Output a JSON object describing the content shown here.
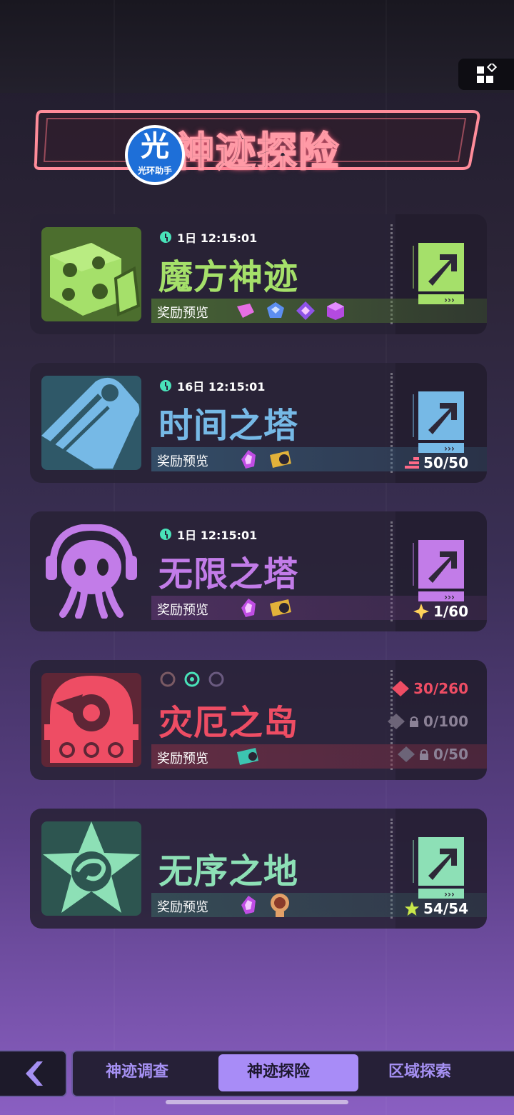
{
  "header": {
    "title": "神迹探险",
    "logo_char": "光",
    "logo_sub": "光环助手"
  },
  "colors": {
    "green": "#a5e06a",
    "blue": "#76b9e6",
    "purple": "#c27ce8",
    "red": "#ee4d64",
    "teal": "#8de0b6",
    "neon": "#ff8c9a"
  },
  "cards": [
    {
      "title": "魔方神迹",
      "timer": "1日 12:15:01",
      "reward_label": "奖励预览",
      "rewards": [
        "pink-crystal-icon",
        "blue-cube-icon",
        "purple-gem-icon",
        "violet-cube-icon"
      ]
    },
    {
      "title": "时间之塔",
      "timer": "16日 12:15:01",
      "reward_label": "奖励预览",
      "rewards": [
        "crystal-icon",
        "record-ticket-icon"
      ],
      "count": "50/50"
    },
    {
      "title": "无限之塔",
      "timer": "1日 12:15:01",
      "reward_label": "奖励预览",
      "rewards": [
        "crystal-icon",
        "record-ticket-icon"
      ],
      "count": "1/60"
    },
    {
      "title": "灾厄之岛",
      "reward_label": "奖励预览",
      "rewards": [
        "teal-ticket-icon"
      ],
      "progress": [
        "30/260",
        "0/100",
        "0/50"
      ]
    },
    {
      "title": "无序之地",
      "reward_label": "奖励预览",
      "rewards": [
        "crystal-icon",
        "astronaut-icon"
      ],
      "count": "54/54"
    }
  ],
  "tabs": [
    {
      "label": "神迹调查"
    },
    {
      "label": "神迹探险",
      "active": true
    },
    {
      "label": "区域探索"
    }
  ],
  "back_label": "‹"
}
